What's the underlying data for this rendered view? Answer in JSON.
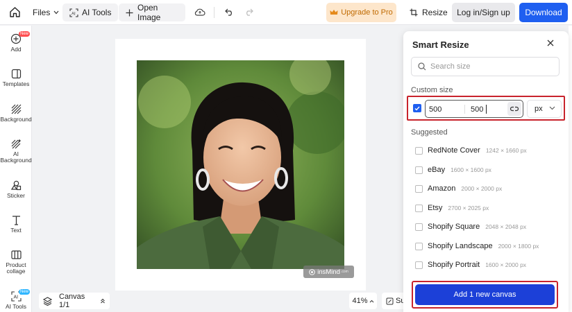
{
  "topbar": {
    "files_label": "Files",
    "ai_tools_label": "AI Tools",
    "open_image_label": "Open Image",
    "upgrade_label": "Upgrade to Pro",
    "resize_label": "Resize",
    "login_label": "Log in/Sign up",
    "download_label": "Download"
  },
  "sidebar": {
    "items": [
      {
        "label": "Add",
        "icon": "plus-circle-icon",
        "badge": "New"
      },
      {
        "label": "Templates",
        "icon": "template-icon"
      },
      {
        "label": "Background",
        "icon": "background-icon"
      },
      {
        "label": "AI Background",
        "icon": "ai-background-icon"
      },
      {
        "label": "Sticker",
        "icon": "sticker-icon"
      },
      {
        "label": "Text",
        "icon": "text-icon"
      },
      {
        "label": "Product collage",
        "icon": "collage-icon"
      },
      {
        "label": "AI Tools",
        "icon": "ai-tools-icon",
        "badge": "New"
      }
    ]
  },
  "canvas": {
    "watermark": "insMind",
    "watermark_suffix": ".com",
    "layer_label": "Canvas 1/1",
    "zoom": "41%",
    "side_button": "Su"
  },
  "panel": {
    "title": "Smart Resize",
    "search_placeholder": "Search size",
    "custom_label": "Custom size",
    "width_value": "500",
    "height_value": "500",
    "unit": "px",
    "suggested_label": "Suggested",
    "suggestions": [
      {
        "name": "RedNote Cover",
        "size": "1242 × 1660 px"
      },
      {
        "name": "eBay",
        "size": "1600 × 1600 px"
      },
      {
        "name": "Amazon",
        "size": "2000 × 2000 px"
      },
      {
        "name": "Etsy",
        "size": "2700 × 2025 px"
      },
      {
        "name": "Shopify Square",
        "size": "2048 × 2048 px"
      },
      {
        "name": "Shopify Landscape",
        "size": "2000 × 1800 px"
      },
      {
        "name": "Shopify Portrait",
        "size": "1600 × 2000 px"
      }
    ],
    "add_button": "Add 1 new canvas"
  },
  "colors": {
    "accent": "#1f5ff0",
    "highlight_border": "#c8232c",
    "upgrade_bg": "#fde6cb"
  }
}
